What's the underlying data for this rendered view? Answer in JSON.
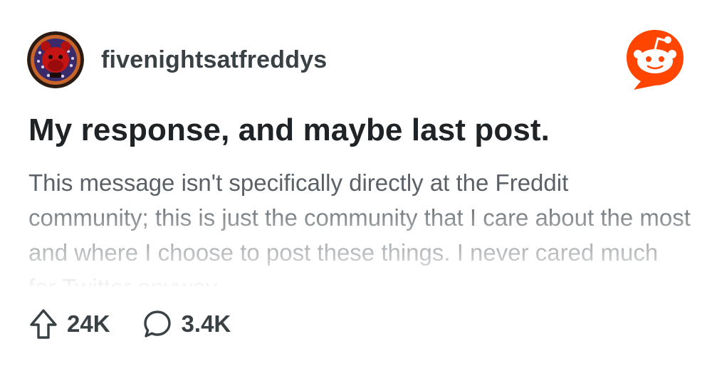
{
  "subreddit": {
    "name": "fivenightsatfreddys",
    "avatar_icon": "freddy-avatar-icon"
  },
  "brand": {
    "logo_icon": "reddit-logo-icon",
    "accent_color": "#ff4500"
  },
  "post": {
    "title": "My response, and maybe last post.",
    "body": "This message isn't specifically directly at the Freddit community; this is just the community that I care about the most and where I choose to post these things. I never cared much for Twitter anyway."
  },
  "actions": {
    "upvote_icon": "upvote-arrow-icon",
    "upvotes": "24K",
    "comment_icon": "comment-bubble-icon",
    "comments": "3.4K"
  }
}
